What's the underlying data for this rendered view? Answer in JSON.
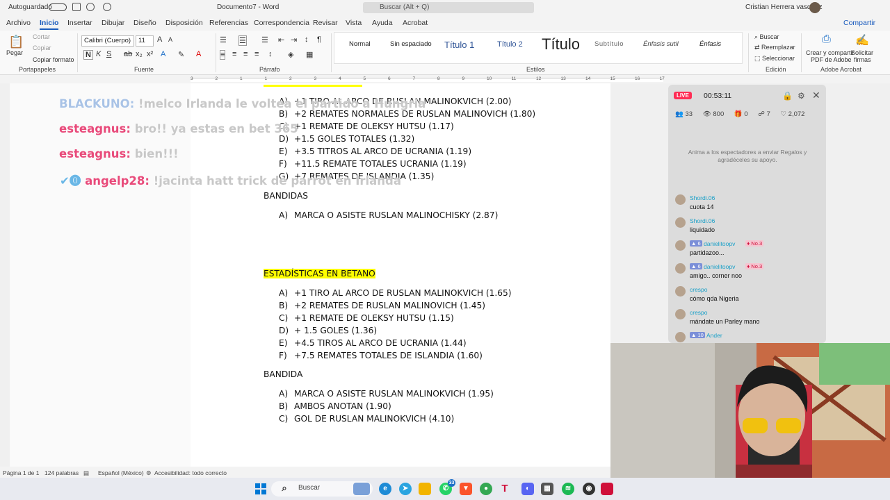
{
  "titlebar": {
    "autosave": "Autoguardado",
    "doc_title": "Documento7 - Word",
    "search_placeholder": "Buscar (Alt + Q)",
    "user": "Cristian Herrera vasquez"
  },
  "tabs": [
    "Archivo",
    "Inicio",
    "Insertar",
    "Dibujar",
    "Diseño",
    "Disposición",
    "Referencias",
    "Correspondencia",
    "Revisar",
    "Vista",
    "Ayuda",
    "Acrobat"
  ],
  "share_label": "Compartir",
  "ribbon": {
    "clipboard": {
      "paste": "Pegar",
      "cut": "Cortar",
      "copy": "Copiar",
      "format_painter": "Copiar formato",
      "label": "Portapapeles"
    },
    "font": {
      "name": "Calibri (Cuerpo)",
      "size": "11",
      "label": "Fuente"
    },
    "paragraph": {
      "label": "Párrafo"
    },
    "styles": {
      "items": [
        "Normal",
        "Sin espaciado",
        "Título 1",
        "Título 2",
        "Título",
        "Subtítulo",
        "Énfasis sutil",
        "Énfasis"
      ],
      "label": "Estilos"
    },
    "editing": {
      "find": "Buscar",
      "replace": "Reemplazar",
      "select": "Seleccionar",
      "label": "Edición"
    },
    "acrobat": {
      "create": "Crear y compartir",
      "create2": "PDF de Adobe",
      "sign": "Solicitar",
      "sign2": "firmas",
      "label": "Adobe Acrobat"
    }
  },
  "ruler": {
    "numbers": [
      "3",
      "2",
      "1",
      "1",
      "2",
      "3",
      "4",
      "5",
      "6",
      "7",
      "8",
      "9",
      "10",
      "11",
      "12",
      "13",
      "14",
      "15",
      "16",
      "17"
    ]
  },
  "overlay_chat": [
    {
      "nick": "BLACKUNO:",
      "msg": "!melco Irlanda le voltea el partido a Hungria",
      "nick_color": "#a9c3e6"
    },
    {
      "nick": "esteagnus:",
      "msg": "bro!! ya estas en bet 365",
      "nick_color": "#e84a7a"
    },
    {
      "nick": "esteagnus:",
      "msg": "bien!!!",
      "nick_color": "#e84a7a"
    },
    {
      "nick": "angelp28:",
      "msg": "!jacinta hatt trick de parrot en Irlanda",
      "nick_color": "#e84a7a"
    }
  ],
  "document": {
    "top_list": [
      {
        "letter": "A)",
        "text": "+1 TIRO AL ARCO DE RUSLAN MALINOKVICH (2.00)"
      },
      {
        "letter": "B)",
        "text": "+2 REMATES NORMALES DE RUSLAN MALINOVICH (1.80)"
      },
      {
        "letter": "C)",
        "text": "+1 REMATE DE OLEKSY HUTSU (1.17)"
      },
      {
        "letter": "D)",
        "text": "+1.5 GOLES TOTALES (1.32)"
      },
      {
        "letter": "E)",
        "text": "+3.5 TITROS AL ARCO DE UCRANIA (1.19)"
      },
      {
        "letter": "F)",
        "text": "+11.5 REMATE TOTALES UCRANIA (1.19)"
      },
      {
        "letter": "G)",
        "text": "+7 REMATES DE ISLANDIA (1.35)"
      }
    ],
    "bandidas_heading": "BANDIDAS",
    "bandidas_list": [
      {
        "letter": "A)",
        "text": "MARCA O ASISTE RUSLAN MALINOCHISKY (2.87)"
      }
    ],
    "betano_heading": "ESTADÍSTICAS EN BETANO",
    "betano_list": [
      {
        "letter": "A)",
        "text": "+1 TIRO AL ARCO DE RUSLAN MALINOKVICH (1.65)"
      },
      {
        "letter": "B)",
        "text": "+2 REMATES DE RUSLAN MALINOVICH (1.45)"
      },
      {
        "letter": "C)",
        "text": "+1 REMATE DE OLEKSY HUTSU (1.15)"
      },
      {
        "letter": "D)",
        "text": "+ 1.5 GOLES (1.36)"
      },
      {
        "letter": "E)",
        "text": "+4.5 TIROS AL ARCO DE UCRANIA (1.44)"
      },
      {
        "letter": "F)",
        "text": "+7.5 REMATES TOTALES DE ISLANDIA (1.60)"
      }
    ],
    "bandida_heading": "BANDIDA",
    "bandida_list": [
      {
        "letter": "A)",
        "text": "MARCA O ASISTE RUSLAN MALINOKVICH (1.95)"
      },
      {
        "letter": "B)",
        "text": "AMBOS ANOTAN (1.90)"
      },
      {
        "letter": "C)",
        "text": "GOL DE RUSLAN MALINOKVICH (4.10)"
      }
    ]
  },
  "live": {
    "badge": "LIVE",
    "time": "00:53:11",
    "stats": [
      "33",
      "800",
      "0",
      "7",
      "2,072"
    ],
    "gift_msg": "Anima a los espectadores a enviar Regalos y agradéceles su apoyo.",
    "chat": [
      {
        "name": "Shordi.06",
        "text": "cuota 14"
      },
      {
        "name": "Shordi.06",
        "text": "liquidado"
      },
      {
        "name": "danielitoopv",
        "level": "6",
        "rank": "No.3",
        "text": "partidazoo..."
      },
      {
        "name": "danielitoopv",
        "level": "6",
        "rank": "No.3",
        "text": "amigo.. corner noo"
      },
      {
        "name": "crespo",
        "text": "cómo qda Nigeria"
      },
      {
        "name": "crespo",
        "text": "mándate un Parley mano"
      },
      {
        "name": "Ander",
        "level": "10",
        "text": ""
      }
    ]
  },
  "status": {
    "page": "Página 1 de 1",
    "words": "124 palabras",
    "lang": "Español (México)",
    "access": "Accesibilidad: todo correcto"
  },
  "taskbar": {
    "search": "Buscar",
    "notification_count": "33"
  },
  "colors": {
    "word_blue": "#185abd",
    "highlight": "#ffff00",
    "live_red": "#ff2d55"
  }
}
